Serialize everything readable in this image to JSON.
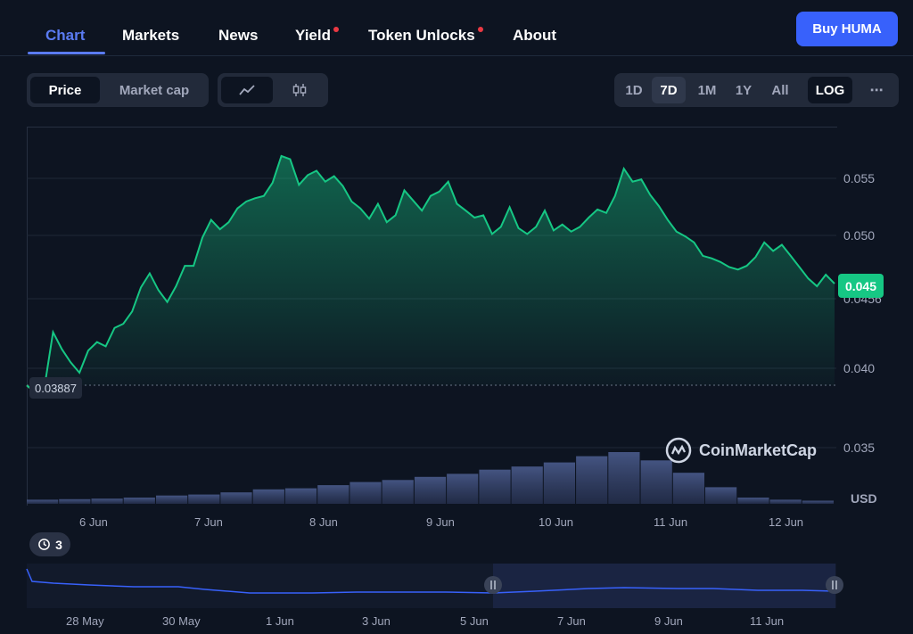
{
  "nav": {
    "tabs": [
      {
        "label": "Chart"
      },
      {
        "label": "Markets"
      },
      {
        "label": "News"
      },
      {
        "label": "Yield"
      },
      {
        "label": "Token Unlocks"
      },
      {
        "label": "About"
      }
    ],
    "buy_label": "Buy HUMA"
  },
  "toolbar": {
    "price_label": "Price",
    "market_cap_label": "Market cap",
    "ranges": [
      "1D",
      "7D",
      "1M",
      "1Y",
      "All"
    ],
    "selected_range": "7D",
    "log_label": "LOG",
    "more_label": "⋯"
  },
  "chart": {
    "current_price": "0.045",
    "open_price": "0.03887",
    "currency": "USD",
    "brand": "CoinMarketCap",
    "history_count": "3",
    "accent_color": "#16c784",
    "y_ticks": [
      "0.055",
      "0.050",
      "0.0456",
      "0.040",
      "0.035"
    ],
    "x_ticks": [
      "6 Jun",
      "7 Jun",
      "8 Jun",
      "9 Jun",
      "10 Jun",
      "11 Jun",
      "12 Jun"
    ],
    "nav_ticks": [
      "28 May",
      "30 May",
      "1 Jun",
      "3 Jun",
      "5 Jun",
      "7 Jun",
      "9 Jun",
      "11 Jun"
    ]
  },
  "chart_data": {
    "type": "line",
    "title": "",
    "xlabel": "",
    "ylabel": "USD",
    "scale": "log",
    "ylim": [
      0.033,
      0.059
    ],
    "series": [
      {
        "values": [
          0.03887,
          0.0384,
          0.0387,
          0.0425,
          0.0413,
          0.0404,
          0.0397,
          0.0412,
          0.0418,
          0.0415,
          0.0428,
          0.0431,
          0.044,
          0.0458,
          0.0469,
          0.0456,
          0.0447,
          0.0459,
          0.0475,
          0.0475,
          0.0498,
          0.0513,
          0.0505,
          0.0511,
          0.0523,
          0.0529,
          0.0532,
          0.0534,
          0.0546,
          0.0571,
          0.0568,
          0.0544,
          0.0553,
          0.0557,
          0.0547,
          0.0552,
          0.0543,
          0.0529,
          0.0523,
          0.0514,
          0.0527,
          0.0511,
          0.0517,
          0.0539,
          0.053,
          0.0521,
          0.0534,
          0.0538,
          0.0547,
          0.0527,
          0.0521,
          0.0515,
          0.0517,
          0.0501,
          0.0507,
          0.0524,
          0.0506,
          0.0501,
          0.0507,
          0.0521,
          0.0504,
          0.0509,
          0.0503,
          0.0507,
          0.0515,
          0.0522,
          0.0519,
          0.0534,
          0.0559,
          0.0547,
          0.0549,
          0.0535,
          0.0525,
          0.0513,
          0.0503,
          0.0499,
          0.0494,
          0.0483,
          0.0481,
          0.0478,
          0.0474,
          0.0472,
          0.0475,
          0.0482,
          0.0494,
          0.0487,
          0.0492,
          0.0483,
          0.0474,
          0.0465,
          0.0459,
          0.0468,
          0.0461
        ]
      }
    ],
    "volume": [
      0.08,
      0.09,
      0.1,
      0.12,
      0.16,
      0.18,
      0.22,
      0.28,
      0.3,
      0.36,
      0.42,
      0.46,
      0.52,
      0.58,
      0.66,
      0.72,
      0.8,
      0.92,
      1.0,
      0.84,
      0.6,
      0.32,
      0.12,
      0.08,
      0.06
    ]
  }
}
